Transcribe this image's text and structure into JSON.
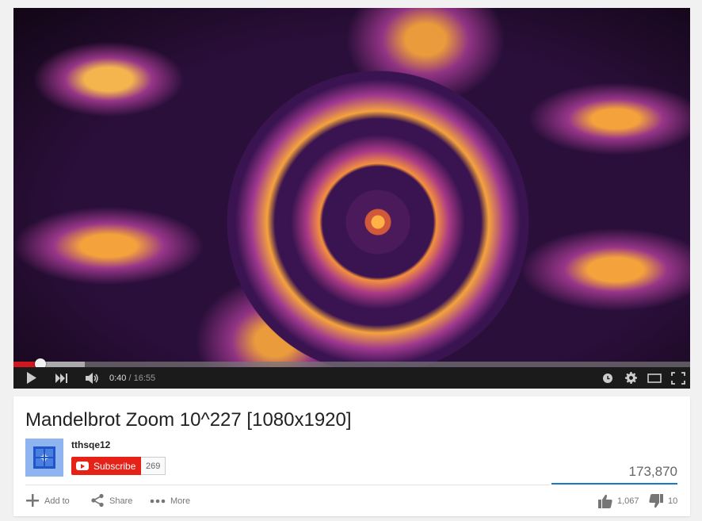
{
  "player": {
    "current_time": "0:40",
    "separator": " / ",
    "duration": "16:55",
    "progress_fraction": 0.0394,
    "progress_color": "#cc181e"
  },
  "video": {
    "title": "Mandelbrot Zoom 10^227 [1080x1920]"
  },
  "channel": {
    "name": "tthsqe12",
    "subscribe_label": "Subscribe",
    "subscriber_count": "269",
    "avatar_color": "#8fb4f0"
  },
  "stats": {
    "views": "173,870",
    "likes": "1,067",
    "dislikes": "10"
  },
  "actions": {
    "add_to": "Add to",
    "share": "Share",
    "more": "More"
  },
  "icons": {
    "play": "play-icon",
    "next": "next-icon",
    "volume": "volume-icon",
    "watch_later": "clock-icon",
    "settings": "gear-icon",
    "theater": "theater-mode-icon",
    "fullscreen": "fullscreen-icon",
    "add": "plus-icon",
    "share": "share-icon",
    "more": "dots-icon",
    "like": "thumbs-up-icon",
    "dislike": "thumbs-down-icon"
  }
}
